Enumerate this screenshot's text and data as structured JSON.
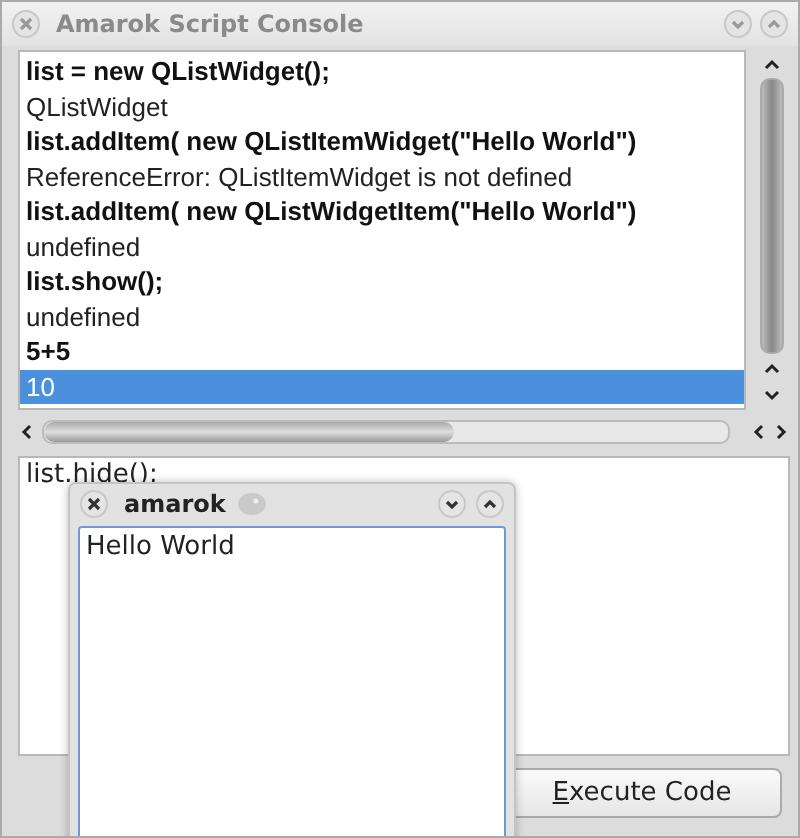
{
  "window": {
    "title": "Amarok Script Console"
  },
  "output": {
    "rows": [
      {
        "text": "list = new QListWidget();",
        "kind": "input",
        "selected": false
      },
      {
        "text": "QListWidget",
        "kind": "result",
        "selected": false
      },
      {
        "text": "list.addItem( new QListItemWidget(\"Hello World\")",
        "kind": "input",
        "selected": false
      },
      {
        "text": "ReferenceError: QListItemWidget is not defined",
        "kind": "result",
        "selected": false
      },
      {
        "text": "list.addItem( new QListWidgetItem(\"Hello World\")",
        "kind": "input",
        "selected": false
      },
      {
        "text": "undefined",
        "kind": "result",
        "selected": false
      },
      {
        "text": "list.show();",
        "kind": "input",
        "selected": false
      },
      {
        "text": "undefined",
        "kind": "result",
        "selected": false
      },
      {
        "text": "5+5",
        "kind": "input",
        "selected": false
      },
      {
        "text": "10",
        "kind": "result",
        "selected": true
      }
    ]
  },
  "editor": {
    "value": "list.hide();"
  },
  "execute_button": {
    "label": "Execute Code"
  },
  "popup": {
    "title": "amarok",
    "items": [
      {
        "text": "Hello World"
      }
    ]
  }
}
